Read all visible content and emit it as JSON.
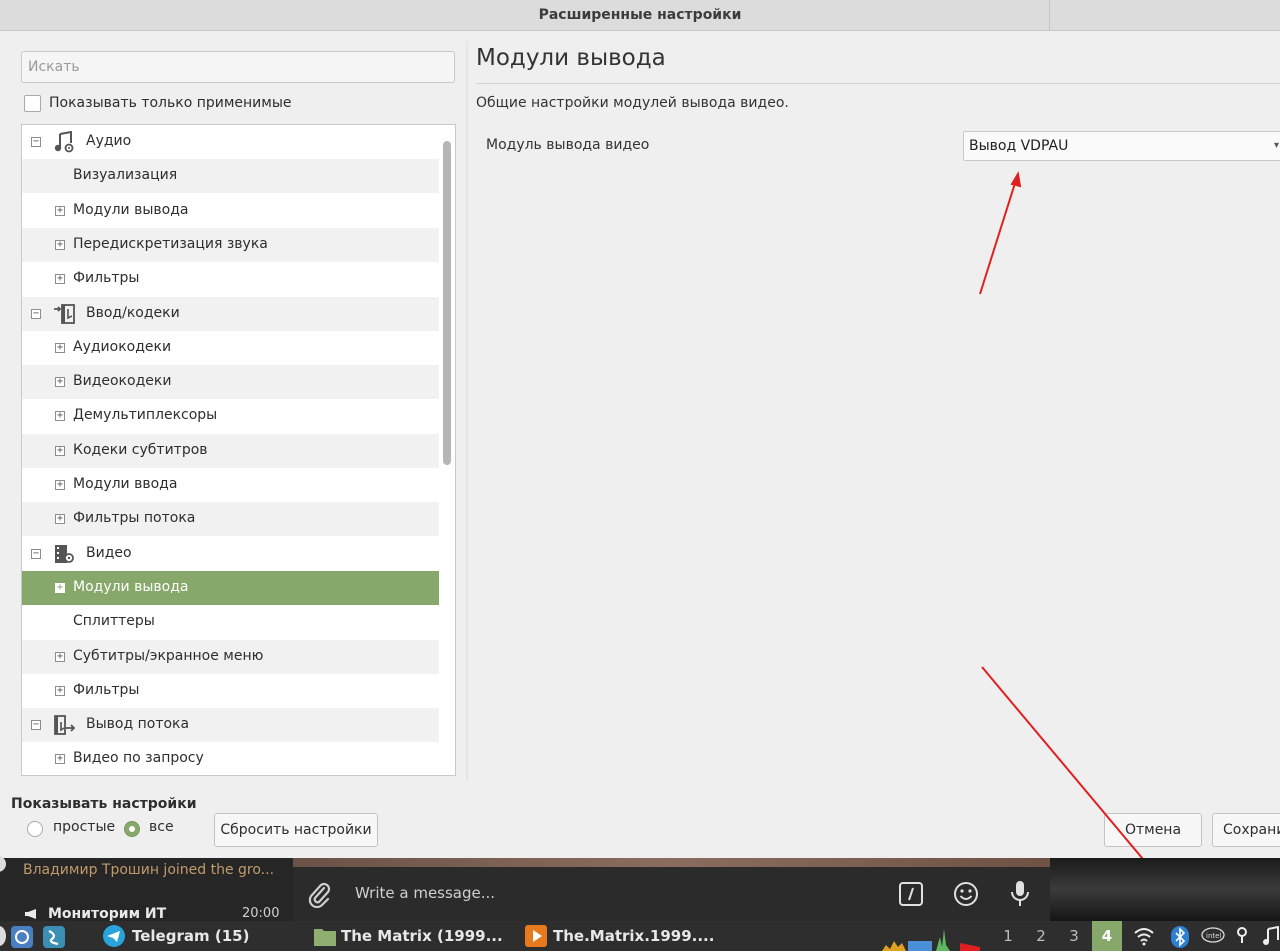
{
  "window": {
    "title": "Расширенные настройки"
  },
  "search": {
    "placeholder": "Искать"
  },
  "filter_checkbox": {
    "label": "Показывать только применимые",
    "checked": false
  },
  "tree": {
    "items": [
      {
        "label": "Аудио",
        "level": 0,
        "expander": "−",
        "icon": "music-note-gear-icon"
      },
      {
        "label": "Визуализация",
        "level": 1,
        "expander": ""
      },
      {
        "label": "Модули вывода",
        "level": 1,
        "expander": "+"
      },
      {
        "label": "Передискретизация звука",
        "level": 1,
        "expander": "+"
      },
      {
        "label": "Фильтры",
        "level": 1,
        "expander": "+"
      },
      {
        "label": "Ввод/кодеки",
        "level": 0,
        "expander": "−",
        "icon": "input-codec-icon"
      },
      {
        "label": "Аудиокодеки",
        "level": 1,
        "expander": "+"
      },
      {
        "label": "Видеокодеки",
        "level": 1,
        "expander": "+"
      },
      {
        "label": "Демультиплексоры",
        "level": 1,
        "expander": "+"
      },
      {
        "label": "Кодеки субтитров",
        "level": 1,
        "expander": "+"
      },
      {
        "label": "Модули ввода",
        "level": 1,
        "expander": "+"
      },
      {
        "label": "Фильтры потока",
        "level": 1,
        "expander": "+"
      },
      {
        "label": "Видео",
        "level": 0,
        "expander": "−",
        "icon": "film-gear-icon"
      },
      {
        "label": "Модули вывода",
        "level": 1,
        "expander": "+",
        "selected": true
      },
      {
        "label": "Сплиттеры",
        "level": 1,
        "expander": ""
      },
      {
        "label": "Субтитры/экранное меню",
        "level": 1,
        "expander": "+"
      },
      {
        "label": "Фильтры",
        "level": 1,
        "expander": "+"
      },
      {
        "label": "Вывод потока",
        "level": 0,
        "expander": "−",
        "icon": "stream-output-icon"
      },
      {
        "label": "Видео по запросу",
        "level": 1,
        "expander": "+"
      }
    ]
  },
  "pane": {
    "title": "Модули вывода",
    "description": "Общие настройки модулей вывода видео.",
    "field_label": "Модуль вывода видео",
    "combo_value": "Вывод VDPAU"
  },
  "show_settings": {
    "label": "Показывать настройки",
    "options": [
      "простые",
      "все"
    ],
    "selected": "все"
  },
  "buttons": {
    "reset": "Сбросить настройки",
    "cancel": "Отмена",
    "save": "Сохрани"
  },
  "telegram": {
    "notification": "Владимир Трошин joined the gro...",
    "chat_name": "Мониторим ИТ",
    "chat_time": "20:00",
    "input_placeholder": "Write a message..."
  },
  "taskbar": {
    "apps": [
      "Telegram (15)",
      "The Matrix (1999...",
      "The.Matrix.1999...."
    ],
    "workspaces": [
      "1",
      "2",
      "3",
      "4"
    ],
    "active_workspace": "4"
  },
  "colors": {
    "accent": "#86a86a",
    "annotation_arrow": "#e02020",
    "dialog_bg": "#efefef",
    "taskbar_bg": "#2e2e2e"
  }
}
